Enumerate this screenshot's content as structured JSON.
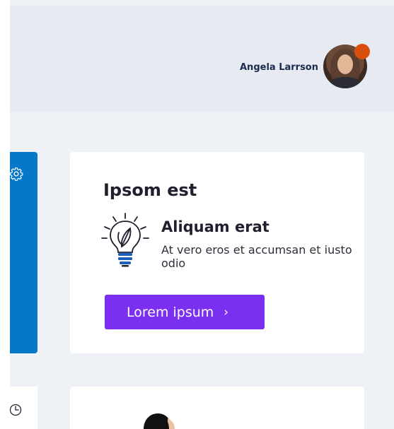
{
  "header": {
    "user_name": "Angela Larrson",
    "status_color": "#d84f0b"
  },
  "sidebar": {
    "panel_color": "#0778c9",
    "settings_icon": "gear-icon",
    "history_icon": "clock-icon"
  },
  "card": {
    "title": "Ipsom est",
    "feature": {
      "icon": "lightbulb-leaf-icon",
      "title": "Aliquam erat",
      "text": "At vero eros et accumsan et iusto odio"
    },
    "button": {
      "label": "Lorem ipsum",
      "icon": "chevron-right-icon",
      "color": "#7b2ff0"
    }
  }
}
